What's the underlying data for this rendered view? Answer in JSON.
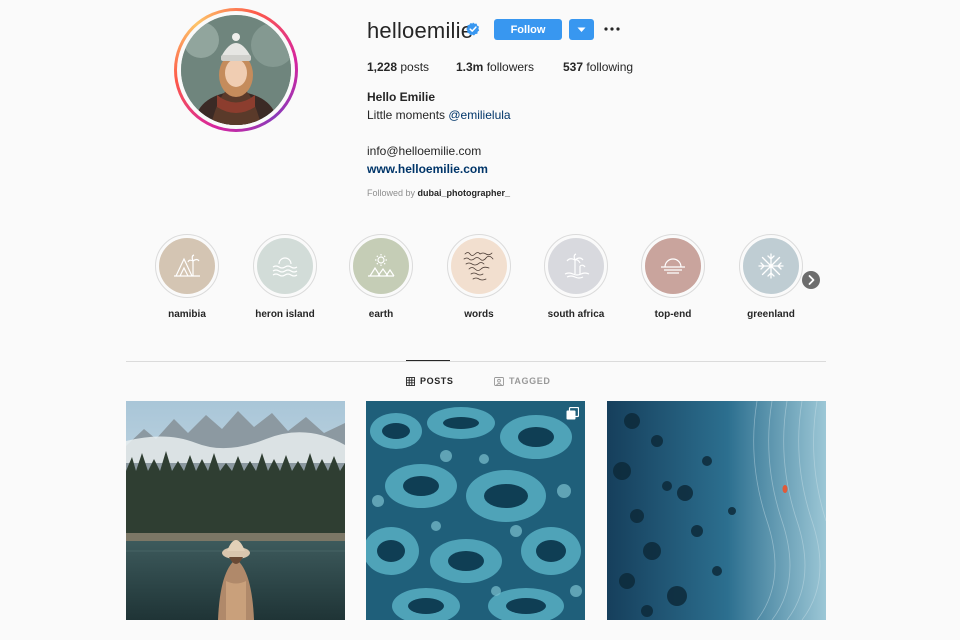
{
  "profile": {
    "username": "helloemilie",
    "verified": true,
    "follow_label": "Follow",
    "stats": {
      "posts_count": "1,228",
      "posts_label": "posts",
      "followers_count": "1.3m",
      "followers_label": "followers",
      "following_count": "537",
      "following_label": "following"
    },
    "full_name": "Hello Emilie",
    "bio_text": "Little moments ",
    "bio_mention": "@emilielula",
    "email": "info@helloemilie.com",
    "website": "www.helloemilie.com",
    "followed_by_prefix": "Followed by ",
    "followed_by_user": "dubai_photographer_"
  },
  "highlights": [
    {
      "label": "namibia",
      "icon": "tree-icon",
      "color": "#d4c5b3"
    },
    {
      "label": "heron island",
      "icon": "waves-icon",
      "color": "#d2dcd8"
    },
    {
      "label": "earth",
      "icon": "sun-landscape-icon",
      "color": "#c5cdb6"
    },
    {
      "label": "words",
      "icon": "handwriting-icon",
      "color": "#f2dfcf"
    },
    {
      "label": "south africa",
      "icon": "palm-icon",
      "color": "#d8d9de"
    },
    {
      "label": "top-end",
      "icon": "sunset-icon",
      "color": "#c9a49d"
    },
    {
      "label": "greenland",
      "icon": "snowflake-icon",
      "color": "#bfcdd3"
    }
  ],
  "tabs": {
    "posts_label": "POSTS",
    "tagged_label": "TAGGED"
  },
  "colors": {
    "accent": "#3897f0",
    "link": "#003569",
    "muted": "#8e8e8e"
  }
}
